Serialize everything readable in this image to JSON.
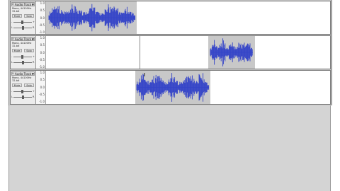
{
  "tracks": [
    {
      "name": "Audio Track",
      "info": [
        "Mono, 44100Hz",
        "32-bit"
      ],
      "mute": "Mute",
      "solo": "Solo",
      "gain_min": "-",
      "gain_max": "+",
      "pan_left": "L",
      "pan_right": "R",
      "ticks": [
        "1.0",
        "0.5",
        "0.0",
        "-0.5",
        "-1.0"
      ]
    },
    {
      "name": "Audio Track",
      "info": [
        "Mono, 44100Hz",
        "32-bit"
      ],
      "mute": "Mute",
      "solo": "Solo",
      "gain_min": "-",
      "gain_max": "+",
      "pan_left": "L",
      "pan_right": "R",
      "ticks": [
        "1.0",
        "0.5",
        "0.0",
        "-0.5",
        "-1.0"
      ]
    },
    {
      "name": "Audio Track",
      "info": [
        "Mono, 44100Hz",
        "32-bit"
      ],
      "mute": "Mute",
      "solo": "Solo",
      "gain_min": "-",
      "gain_max": "+",
      "pan_left": "L",
      "pan_right": "R",
      "ticks": [
        "1.0",
        "0.5",
        "0.0",
        "-0.5",
        "-1.0"
      ]
    }
  ],
  "icons": {
    "close": "x",
    "dropdown": "▼"
  },
  "colors": {
    "waveform": "#3343c8",
    "clip_bg": "#c8c8c8",
    "track_bg": "#ffffff"
  }
}
